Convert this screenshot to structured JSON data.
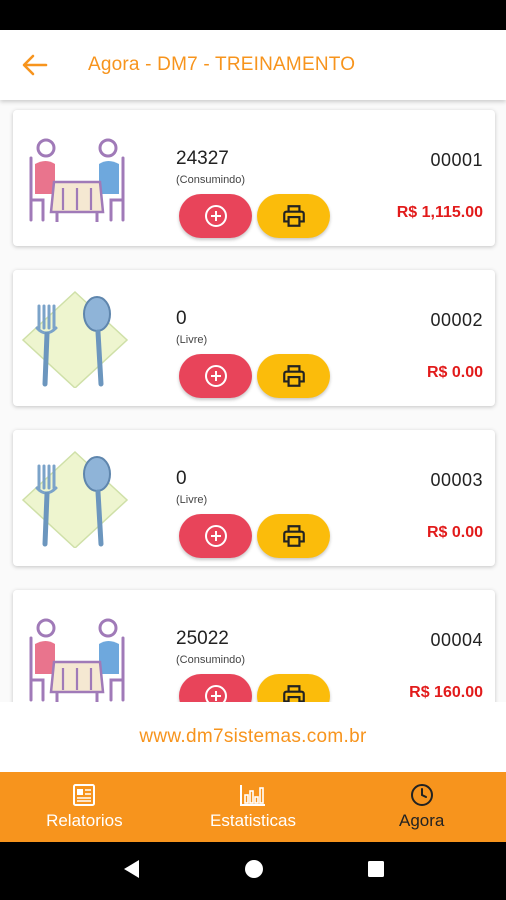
{
  "header": {
    "title": "Agora - DM7 - TREINAMENTO"
  },
  "tables": [
    {
      "code": "24327",
      "status": "(Consumindo)",
      "number": "00001",
      "total": "R$ 1,115.00",
      "image": "occupied-table"
    },
    {
      "code": "0",
      "status": "(Livre)",
      "number": "00002",
      "total": "R$ 0.00",
      "image": "cutlery"
    },
    {
      "code": "0",
      "status": "(Livre)",
      "number": "00003",
      "total": "R$ 0.00",
      "image": "cutlery"
    },
    {
      "code": "25022",
      "status": "(Consumindo)",
      "number": "00004",
      "total": "R$ 160.00",
      "image": "occupied-table"
    }
  ],
  "footer": {
    "website": "www.dm7sistemas.com.br"
  },
  "nav": [
    {
      "label": "Relatorios",
      "icon": "newspaper-icon"
    },
    {
      "label": "Estatisticas",
      "icon": "bar-chart-icon"
    },
    {
      "label": "Agora",
      "icon": "clock-icon",
      "active": true
    }
  ],
  "colors": {
    "accent": "#f7941d",
    "add_button": "#e8445a",
    "print_button": "#fbbc0b",
    "total": "#e21b1b"
  }
}
